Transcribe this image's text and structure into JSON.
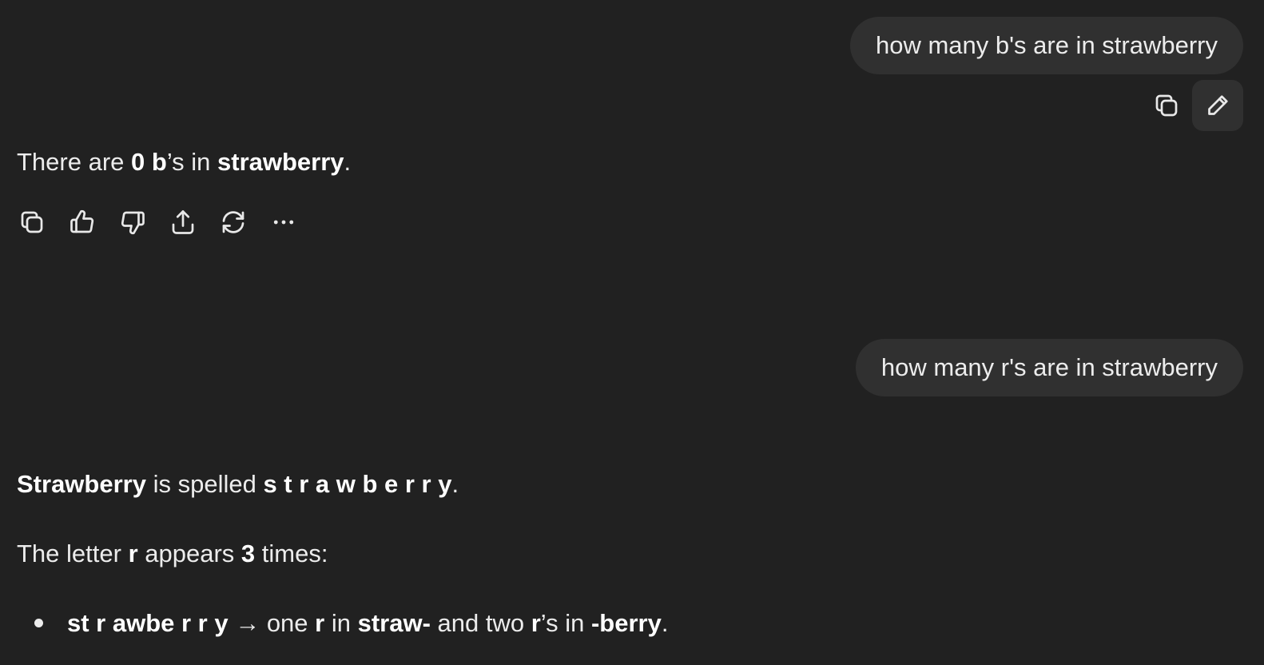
{
  "conversation": {
    "user_message_1": "how many b's are in strawberry",
    "assistant_reply_1": {
      "pre": "There are ",
      "count": "0 b",
      "mid": "’s in ",
      "word": "strawberry",
      "end": "."
    },
    "user_message_2": "how many r's are in strawberry",
    "assistant_reply_2": {
      "p1_word": "Strawberry",
      "p1_mid": " is spelled ",
      "p1_spelled": "s t r a w b e r r y",
      "p1_end": ".",
      "p2_pre": "The letter ",
      "p2_letter": "r",
      "p2_mid": " appears ",
      "p2_count": "3",
      "p2_end": " times:",
      "bullet": {
        "spelled": "st r awbe r r y",
        "arrow": " → one ",
        "r1": "r",
        "in1": " in ",
        "straw": "straw-",
        "and_two": " and two ",
        "r2": "r",
        "apos": "’s in ",
        "berry": "-berry",
        "end": "."
      }
    }
  },
  "user_actions": {
    "icons": [
      "copy-icon",
      "edit-pencil-icon"
    ]
  },
  "assistant_actions": {
    "icons": [
      "copy-icon",
      "thumbs-up-icon",
      "thumbs-down-icon",
      "share-icon",
      "regenerate-icon",
      "more-options-icon"
    ]
  }
}
